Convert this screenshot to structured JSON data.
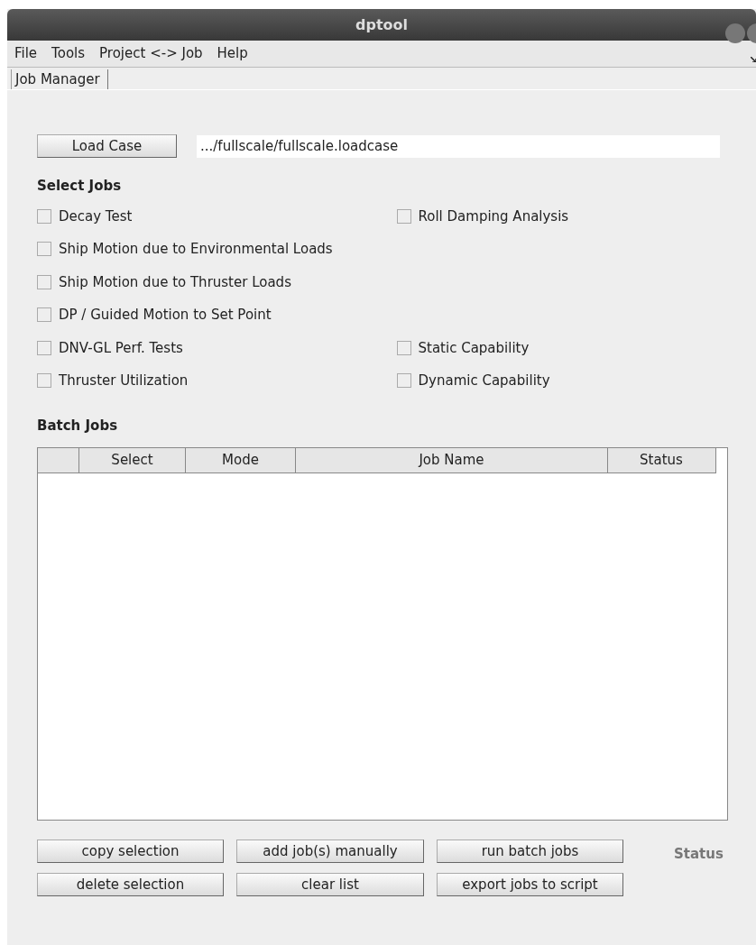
{
  "window": {
    "title": "dptool"
  },
  "menu": [
    "File",
    "Tools",
    "Project <-> Job",
    "Help"
  ],
  "tabs": [
    {
      "label": "Job Manager",
      "selected": true
    }
  ],
  "load_case": {
    "button": "Load Case",
    "path": ".../fullscale/fullscale.loadcase"
  },
  "select_jobs": {
    "heading": "Select Jobs",
    "rows": [
      {
        "left": {
          "label": "Decay Test",
          "checked": false
        },
        "right": {
          "label": "Roll Damping Analysis",
          "checked": false
        }
      },
      {
        "left": {
          "label": "Ship Motion due to Environmental Loads",
          "checked": false
        }
      },
      {
        "left": {
          "label": "Ship Motion due to Thruster Loads",
          "checked": false
        }
      },
      {
        "left": {
          "label": "DP / Guided Motion to Set Point",
          "checked": false
        }
      },
      {
        "left": {
          "label": "DNV-GL Perf. Tests",
          "checked": false
        },
        "right": {
          "label": "Static Capability",
          "checked": false
        }
      },
      {
        "left": {
          "label": "Thruster Utilization",
          "checked": false
        },
        "right": {
          "label": "Dynamic Capability",
          "checked": false
        }
      }
    ]
  },
  "batch_jobs": {
    "heading": "Batch Jobs",
    "columns": [
      "Select",
      "Mode",
      "Job Name",
      "Status"
    ]
  },
  "buttons": [
    [
      "copy selection",
      "add job(s) manually",
      "run batch jobs"
    ],
    [
      "delete selection",
      "clear list",
      "export jobs to script"
    ]
  ],
  "status": "Status"
}
